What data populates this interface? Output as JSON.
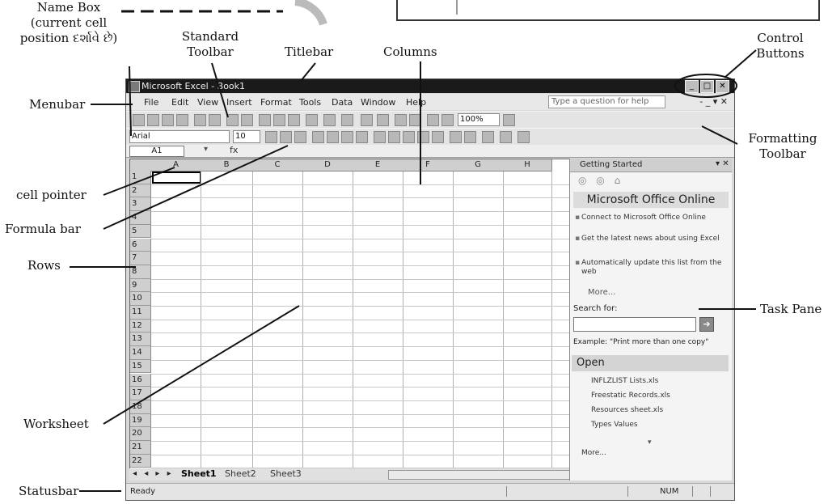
{
  "labels": {
    "name_box": [
      "Name Box",
      "(current cell",
      "position દર્શાવે છે)"
    ],
    "standard_toolbar": [
      "Standard",
      "Toolbar"
    ],
    "titlebar": "Titlebar",
    "columns": "Columns",
    "control_buttons": [
      "Control",
      "Buttons"
    ],
    "menubar": "Menubar",
    "formatting_toolbar": [
      "Formatting",
      "Toolbar"
    ],
    "cell_pointer": "cell pointer",
    "formula_bar": "Formula bar",
    "rows": "Rows",
    "task_pane": "Task Pane",
    "worksheet": "Worksheet",
    "statusbar": "Statusbar"
  },
  "excel": {
    "title": "Microsoft Excel - Book1",
    "menu": [
      "File",
      "Edit",
      "View",
      "Insert",
      "Format",
      "Tools",
      "Data",
      "Window",
      "Help"
    ],
    "help_placeholder": "Type a question for help",
    "menu_right": "- _ ▾ ✕",
    "font_name": "Arial",
    "font_size": "10",
    "zoom": "100%",
    "name_box_value": "A1",
    "fx": "fx",
    "columns": [
      "A",
      "B",
      "C",
      "D",
      "E",
      "F",
      "G",
      "H"
    ],
    "rows": [
      "1",
      "2",
      "3",
      "4",
      "5",
      "6",
      "7",
      "8",
      "9",
      "10",
      "11",
      "12",
      "13",
      "14",
      "15",
      "16",
      "17",
      "18",
      "19",
      "20",
      "21",
      "22"
    ],
    "sheet_nav": "◂ ◂ ▸ ▸",
    "sheets": [
      "Sheet1",
      "Sheet2",
      "Sheet3"
    ],
    "status_left": "Ready",
    "status_num": "NUM"
  },
  "task_pane": {
    "header": "Getting Started",
    "close": "▾ ✕",
    "nav": "◎ ◎ ⌂",
    "office_online": "Microsoft Office Online",
    "bullets": [
      "Connect to Microsoft Office Online",
      "Get the latest news about using Excel",
      "Automatically update this list from the web"
    ],
    "more": "More...",
    "search_label": "Search for:",
    "search_go": "➔",
    "example": "Example: \"Print more than one copy\"",
    "open_header": "Open",
    "open_items": [
      "INFLZLIST Lists.xls",
      "Freestatic Records.xls",
      "Resources sheet.xls",
      "Types Values"
    ],
    "more2": "More...",
    "dropdown": "▾"
  }
}
